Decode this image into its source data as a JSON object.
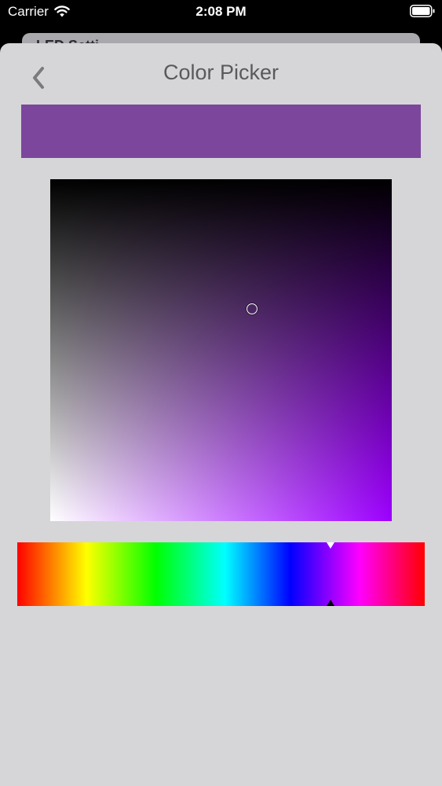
{
  "status_bar": {
    "carrier": "Carrier",
    "time": "2:08 PM",
    "wifi_icon": "wifi-icon",
    "battery_icon": "battery-icon"
  },
  "background_sheet": {
    "title": "LED Setti"
  },
  "header": {
    "title": "Color Picker",
    "back_icon": "chevron-left-icon"
  },
  "picker": {
    "selected_color": "#7c469c",
    "hue_degrees": 277,
    "saturation": 0.59,
    "brightness": 0.62
  },
  "colors": {
    "sheet_background": "#d6d6d8",
    "title_color": "#5a5a5c"
  }
}
